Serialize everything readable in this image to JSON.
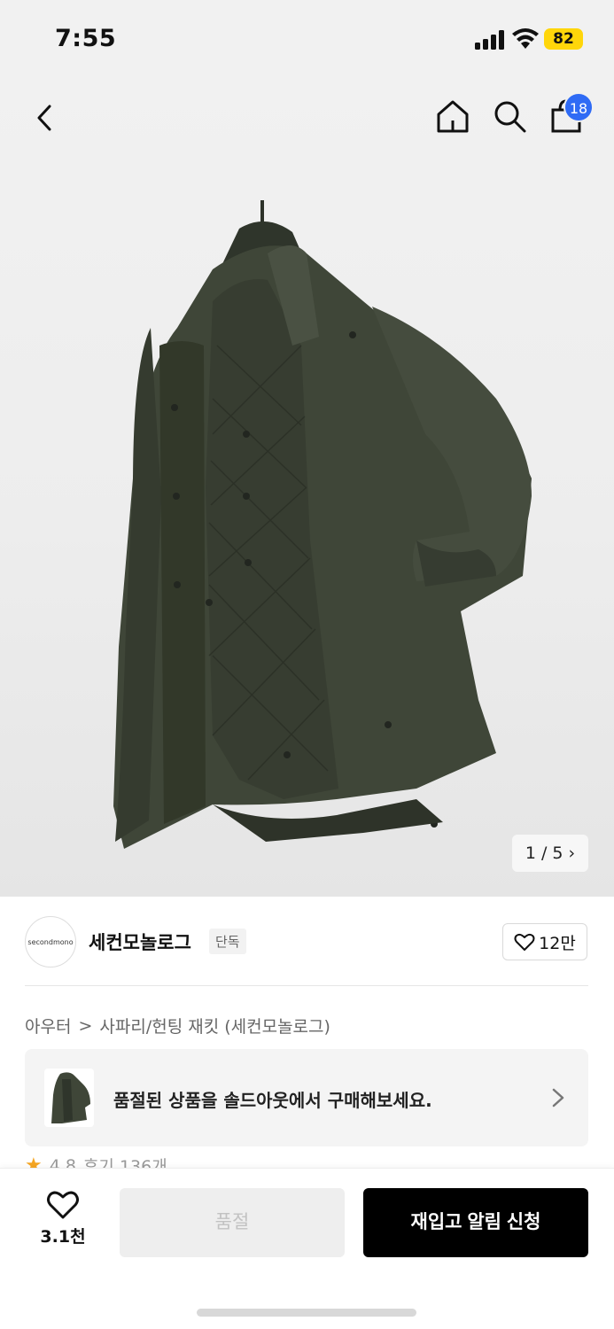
{
  "status_bar": {
    "time": "7:55",
    "battery": "82"
  },
  "header": {
    "cart_count": "18"
  },
  "gallery": {
    "page_indicator": "1 / 5"
  },
  "brand": {
    "logo_text": "secondmono",
    "name": "세컨모놀로그",
    "tag": "단독",
    "likes": "12만"
  },
  "breadcrumb": {
    "category": "아우터",
    "separator": ">",
    "subcategory": "사파리/헌팅 재킷 (세컨모놀로그)"
  },
  "soldout_banner": {
    "text": "품절된 상품을 솔드아웃에서 구매해보세요."
  },
  "rating": {
    "score": "4.8",
    "reviews": "후기 136개"
  },
  "bottom_bar": {
    "like_count": "3.1천",
    "soldout_label": "품절",
    "restock_label": "재입고 알림 신청"
  },
  "colors": {
    "accent_blue": "#2f6bf5",
    "battery_yellow": "#ffd60a",
    "jacket_olive": "#3d4436"
  },
  "icons": [
    "back-icon",
    "home-icon",
    "search-icon",
    "shopping-bag-icon",
    "heart-icon",
    "chevron-right-icon",
    "star-icon"
  ]
}
